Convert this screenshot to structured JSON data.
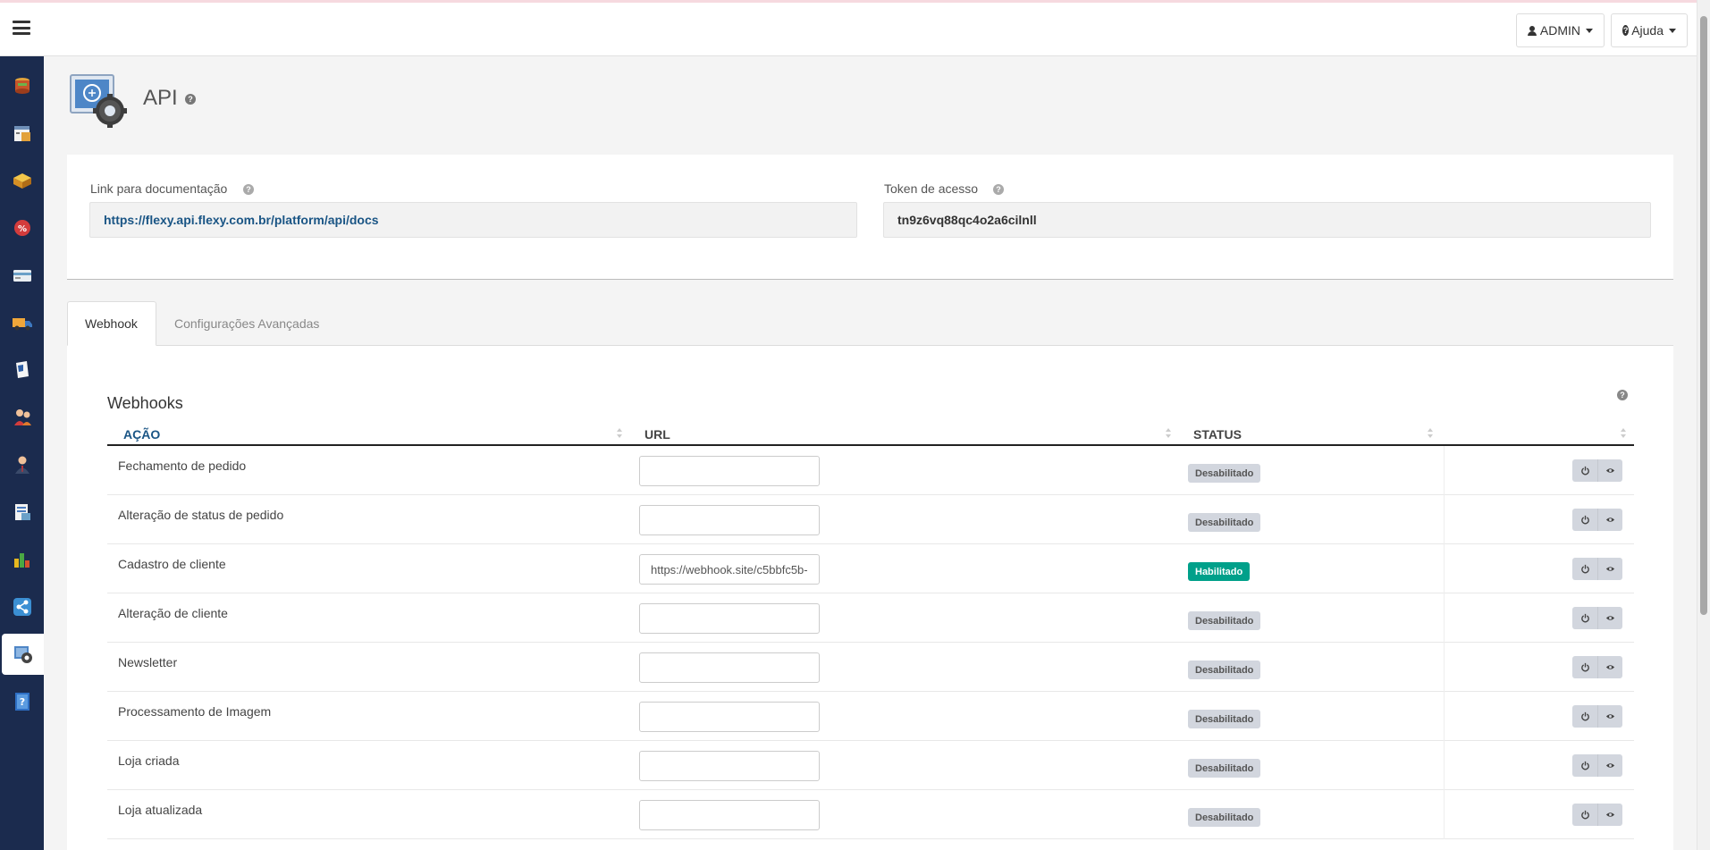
{
  "header": {
    "admin_label": "ADMIN",
    "help_label": "Ajuda"
  },
  "sidebar": {
    "items": [
      {
        "icon": "database-icon"
      },
      {
        "icon": "catalog-icon"
      },
      {
        "icon": "boxes-icon"
      },
      {
        "icon": "discount-icon"
      },
      {
        "icon": "payment-card-icon"
      },
      {
        "icon": "delivery-truck-icon"
      },
      {
        "icon": "document-icon"
      },
      {
        "icon": "customers-icon"
      },
      {
        "icon": "user-admin-icon"
      },
      {
        "icon": "reports-icon"
      },
      {
        "icon": "stats-icon"
      },
      {
        "icon": "share-icon"
      },
      {
        "icon": "api-gear-icon"
      },
      {
        "icon": "help-book-icon"
      }
    ],
    "active_index": 12
  },
  "page": {
    "title": "API",
    "help_glyph": "?"
  },
  "doc_field": {
    "label": "Link para documentação",
    "value": "https://flexy.api.flexy.com.br/platform/api/docs"
  },
  "token_field": {
    "label": "Token de acesso",
    "value": "tn9z6vq88qc4o2a6cilnll"
  },
  "tabs": [
    {
      "label": "Webhook",
      "active": true
    },
    {
      "label": "Configurações Avançadas",
      "active": false
    }
  ],
  "webhooks": {
    "title": "Webhooks",
    "columns": [
      "AÇÃO",
      "URL",
      "STATUS",
      ""
    ],
    "rows": [
      {
        "acao": "Fechamento de pedido",
        "url": "",
        "status": "Desabilitado",
        "enabled": false
      },
      {
        "acao": "Alteração de status de pedido",
        "url": "",
        "status": "Desabilitado",
        "enabled": false
      },
      {
        "acao": "Cadastro de cliente",
        "url": "https://webhook.site/c5bbfc5b-",
        "status": "Habilitado",
        "enabled": true
      },
      {
        "acao": "Alteração de cliente",
        "url": "",
        "status": "Desabilitado",
        "enabled": false
      },
      {
        "acao": "Newsletter",
        "url": "",
        "status": "Desabilitado",
        "enabled": false
      },
      {
        "acao": "Processamento de Imagem",
        "url": "",
        "status": "Desabilitado",
        "enabled": false
      },
      {
        "acao": "Loja criada",
        "url": "",
        "status": "Desabilitado",
        "enabled": false
      },
      {
        "acao": "Loja atualizada",
        "url": "",
        "status": "Desabilitado",
        "enabled": false
      }
    ]
  },
  "colors": {
    "sidebar_bg": "#1b2b4e",
    "link": "#1a5585",
    "enabled": "#00a08a",
    "disabled": "#d2d6de"
  }
}
